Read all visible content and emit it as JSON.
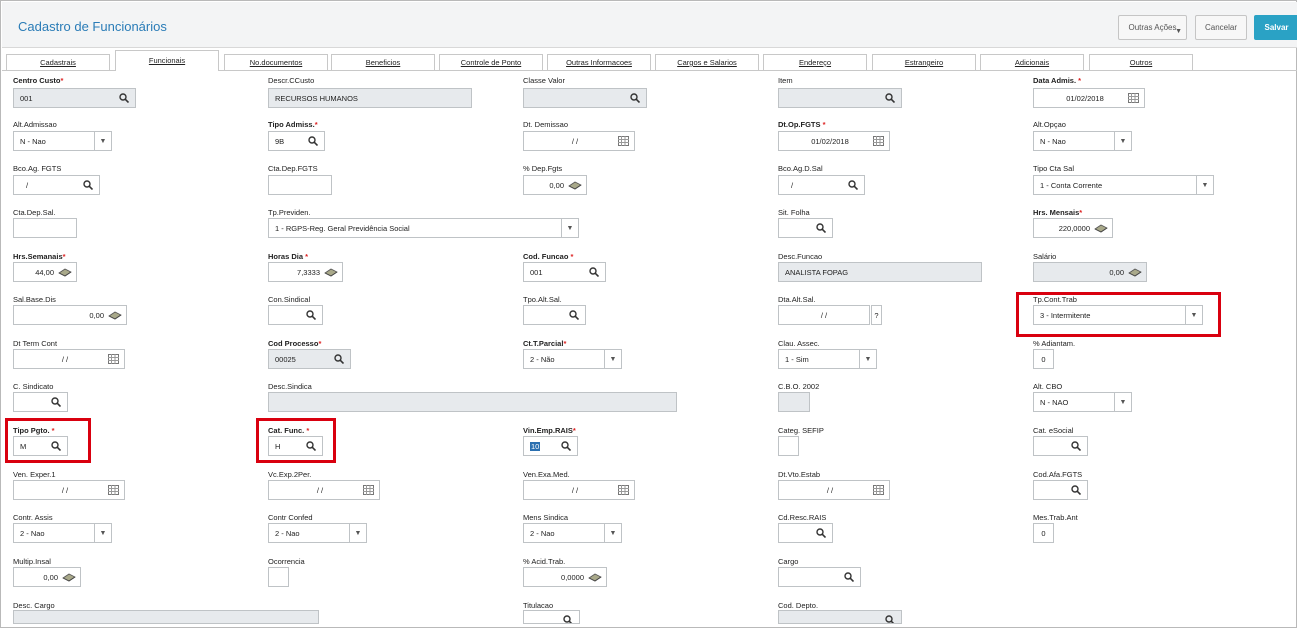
{
  "header": {
    "title": "Cadastro de Funcionários",
    "outras_label": "Outras Ações",
    "cancelar_label": "Cancelar",
    "salvar_label": "Salvar"
  },
  "tabs": [
    "Cadastrais",
    "Funcionais",
    "No.documentos",
    "Beneficios",
    "Controle de Ponto",
    "Outras Informacoes",
    "Cargos e Salarios",
    "Endereço",
    "Estrangeiro",
    "Adicionais",
    "Outros"
  ],
  "fields": {
    "centro_custo": {
      "label": "Centro Custo",
      "value": "001"
    },
    "desc_ccusto": {
      "label": "Descr.CCusto",
      "value": "RECURSOS HUMANOS"
    },
    "classe_valor": {
      "label": "Classe Valor",
      "value": ""
    },
    "item": {
      "label": "Item",
      "value": ""
    },
    "data_admis": {
      "label": "Data Admis.",
      "value": "01/02/2018"
    },
    "alt_admissao": {
      "label": "Alt.Admissao",
      "value": "N - Nao"
    },
    "tipo_admis": {
      "label": "Tipo Admiss.",
      "value": "9B"
    },
    "dt_demissao": {
      "label": "Dt. Demissao",
      "value": "/ /"
    },
    "dt_op_fgts": {
      "label": "Dt.Op.FGTS",
      "value": "01/02/2018"
    },
    "alt_opcao": {
      "label": "Alt.Opçao",
      "value": "N - Nao"
    },
    "bco_ag_fgts": {
      "label": "Bco.Ag. FGTS",
      "value": "/"
    },
    "cta_dep_fgts": {
      "label": "Cta.Dep.FGTS",
      "value": ""
    },
    "pct_dep_fgts": {
      "label": "% Dep.Fgts",
      "value": "0,00"
    },
    "bco_ag_d_sal": {
      "label": "Bco.Ag.D.Sal",
      "value": "/"
    },
    "tipo_cta_sal": {
      "label": "Tipo Cta Sal",
      "value": "1 - Conta Corrente"
    },
    "cta_dep_sal": {
      "label": "Cta.Dep.Sal.",
      "value": ""
    },
    "tp_previden": {
      "label": "Tp.Previden.",
      "value": "1 - RGPS-Reg. Geral Previdência Social"
    },
    "sit_folha": {
      "label": "Sit. Folha",
      "value": ""
    },
    "hrs_mensais": {
      "label": "Hrs. Mensais",
      "value": "220,0000"
    },
    "hrs_semanais": {
      "label": "Hrs.Semanais",
      "value": "44,00"
    },
    "horas_dia": {
      "label": "Horas Dia",
      "value": "7,3333"
    },
    "cod_funcao": {
      "label": "Cod. Funcao",
      "value": "001"
    },
    "desc_funcao": {
      "label": "Desc.Funcao",
      "value": "ANALISTA FOPAG"
    },
    "salario": {
      "label": "Salário",
      "value": "0,00"
    },
    "sal_base_dis": {
      "label": "Sal.Base.Dis",
      "value": "0,00"
    },
    "con_sindical": {
      "label": "Con.Sindical",
      "value": ""
    },
    "tpo_alt_sal": {
      "label": "Tpo.Alt.Sal.",
      "value": ""
    },
    "dta_alt_sal": {
      "label": "Dta.Alt.Sal.",
      "value": "/ /",
      "help": "?"
    },
    "tp_cont_trab": {
      "label": "Tp.Cont.Trab",
      "value": "3 - Intermitente"
    },
    "dt_term_cont": {
      "label": "Dt Term Cont",
      "value": "/ /"
    },
    "cod_processo": {
      "label": "Cod Processo",
      "value": "00025"
    },
    "ct_t_parcial": {
      "label": "Ct.T.Parcial",
      "value": "2 - Não"
    },
    "clau_assec": {
      "label": "Clau. Assec.",
      "value": "1 - Sim"
    },
    "pct_adiantam": {
      "label": "% Adiantam.",
      "value": "0"
    },
    "c_sindicato": {
      "label": "C. Sindicato",
      "value": ""
    },
    "desc_sindica": {
      "label": "Desc.Sindica",
      "value": ""
    },
    "cbo_2002": {
      "label": "C.B.O. 2002",
      "value": ""
    },
    "alt_cbo": {
      "label": "Alt. CBO",
      "value": "N - NAO"
    },
    "tipo_pgto": {
      "label": "Tipo Pgto.",
      "value": "M"
    },
    "cat_func": {
      "label": "Cat. Func.",
      "value": "H"
    },
    "vin_emp_rais": {
      "label": "Vin.Emp.RAIS",
      "value": "10"
    },
    "categ_sefip": {
      "label": "Categ. SEFIP",
      "value": ""
    },
    "cat_esocial": {
      "label": "Cat. eSocial",
      "value": ""
    },
    "ven_exper_1": {
      "label": "Ven. Exper.1",
      "value": "/ /"
    },
    "vc_exp_2per": {
      "label": "Vc.Exp.2Per.",
      "value": "/ /"
    },
    "ven_exa_med": {
      "label": "Ven.Exa.Med.",
      "value": "/ /"
    },
    "dt_vto_estab": {
      "label": "Dt.Vto.Estab",
      "value": "/ /"
    },
    "cod_afa_fgts": {
      "label": "Cod.Afa.FGTS",
      "value": ""
    },
    "contr_assis": {
      "label": "Contr. Assis",
      "value": "2 - Nao"
    },
    "contr_confed": {
      "label": "Contr Confed",
      "value": "2 - Nao"
    },
    "mens_sindica": {
      "label": "Mens Sindica",
      "value": "2 - Nao"
    },
    "cd_resc_rais": {
      "label": "Cd.Resc.RAIS",
      "value": ""
    },
    "mes_trab_ant": {
      "label": "Mes.Trab.Ant",
      "value": "0"
    },
    "multip_insal": {
      "label": "Multip.Insal",
      "value": "0,00"
    },
    "ocorrencia": {
      "label": "Ocorrencia",
      "value": ""
    },
    "pct_acid_trab": {
      "label": "% Acid.Trab.",
      "value": "0,0000"
    },
    "cargo": {
      "label": "Cargo",
      "value": ""
    },
    "desc_cargo": {
      "label": "Desc. Cargo",
      "value": ""
    },
    "titulacao": {
      "label": "Titulacao",
      "value": ""
    },
    "cod_depto": {
      "label": "Cod. Depto.",
      "value": ""
    }
  },
  "required_mark": "*",
  "colors": {
    "accent": "#2aa2c5",
    "title": "#2a7cb7",
    "highlight": "#d9000f",
    "readonly": "#e7eaed"
  }
}
